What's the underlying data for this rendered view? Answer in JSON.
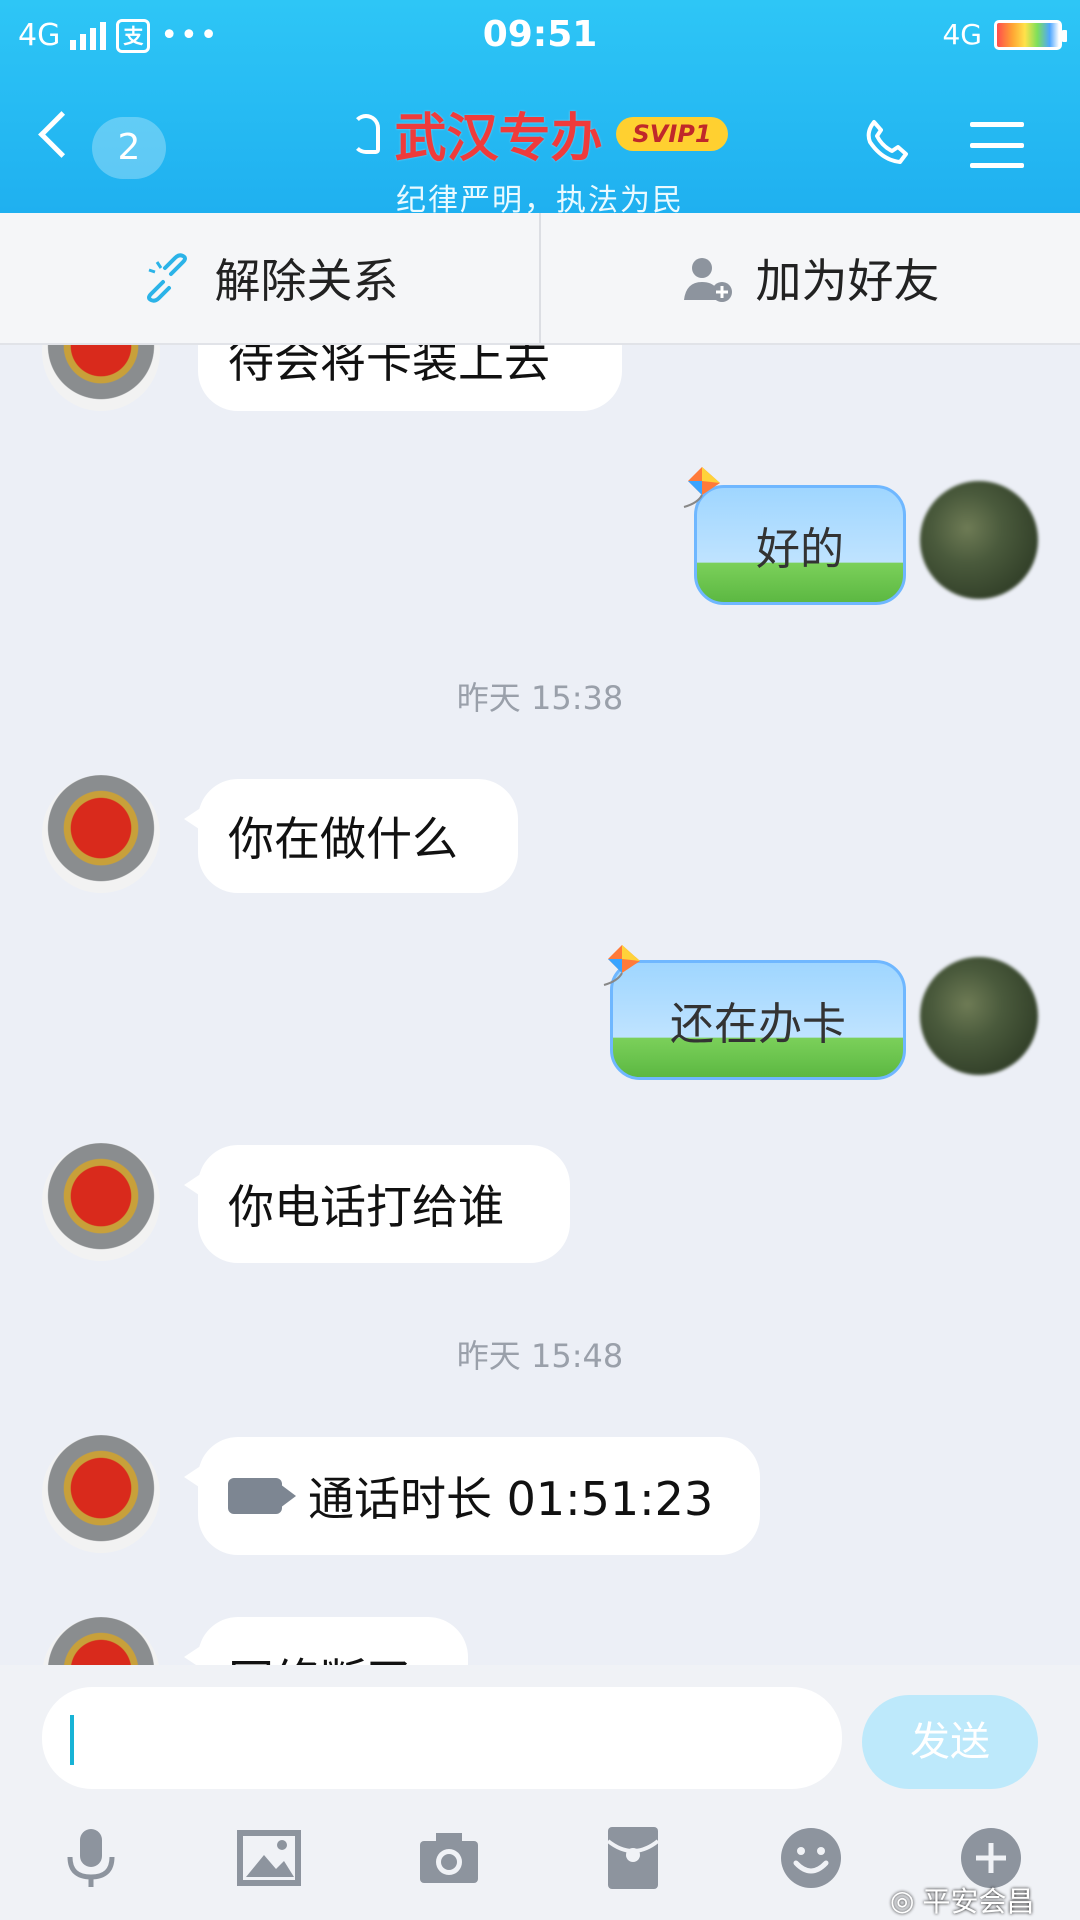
{
  "status_bar": {
    "network": "4G",
    "time": "09:51",
    "right_network": "4G"
  },
  "header": {
    "back_badge": "2",
    "title": "武汉专办",
    "vip": "SVIP1",
    "subtitle": "纪律严明，执法为民",
    "bg_color": "#26bcf4"
  },
  "actions": {
    "unlink_label": "解除关系",
    "add_friend_label": "加为好友"
  },
  "messages": {
    "m1": "待会将卡装上去",
    "m2": "好的",
    "ts1": "昨天 15:38",
    "m3": "你在做什么",
    "m4": "还在办卡",
    "m5": "你电话打给谁",
    "ts2": "昨天 15:48",
    "m6": "通话时长 01:51:23",
    "m7": "网络断了"
  },
  "input": {
    "send_label": "发送"
  },
  "watermark": "平安会昌"
}
